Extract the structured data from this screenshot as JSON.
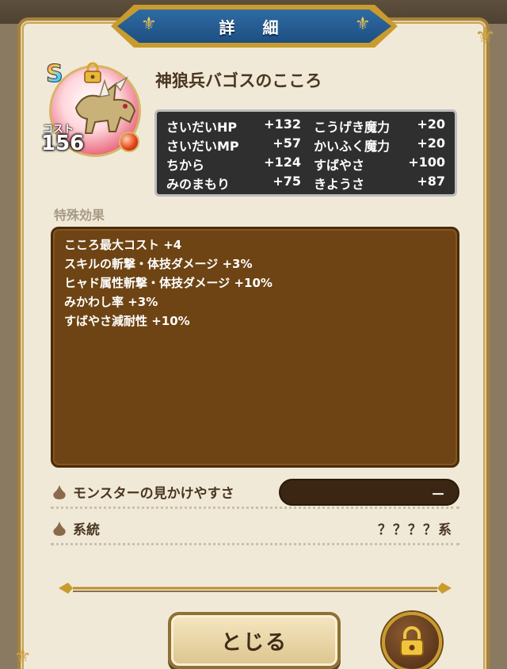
{
  "header": {
    "title": "詳 細"
  },
  "monster": {
    "rank": "S",
    "cost_label": "コスト",
    "cost": "156",
    "name": "神狼兵バゴスのこころ"
  },
  "stats": [
    {
      "left_label": "さいだいHP",
      "left_value": "+132",
      "right_label": "こうげき魔力",
      "right_value": "+20"
    },
    {
      "left_label": "さいだいMP",
      "left_value": "+57",
      "right_label": "かいふく魔力",
      "right_value": "+20"
    },
    {
      "left_label": "ちから",
      "left_value": "+124",
      "right_label": "すばやさ",
      "right_value": "+100"
    },
    {
      "left_label": "みのまもり",
      "left_value": "+75",
      "right_label": "きようさ",
      "right_value": "+87"
    }
  ],
  "effects": {
    "heading": "特殊効果",
    "lines": [
      "こころ最大コスト +4",
      "スキルの斬撃・体技ダメージ +3%",
      "ヒャド属性斬撃・体技ダメージ +10%",
      "みかわし率 +3%",
      "すばやさ減耐性 +10%"
    ]
  },
  "info": {
    "visibility_label": "モンスターの見かけやすさ",
    "visibility_value": "－",
    "lineage_label": "系統",
    "lineage_value": "？？？？系"
  },
  "buttons": {
    "close_label": "とじる"
  },
  "colors": {
    "panel": "#f1e9d8",
    "title_blue": "#1d4f82",
    "gold": "#c99b2e",
    "stats_bg": "#2f2f2f",
    "effects_bg": "#6e4414"
  },
  "icons": [
    "fleur-icon",
    "lock-icon",
    "drop-icon",
    "red-orb-icon"
  ]
}
